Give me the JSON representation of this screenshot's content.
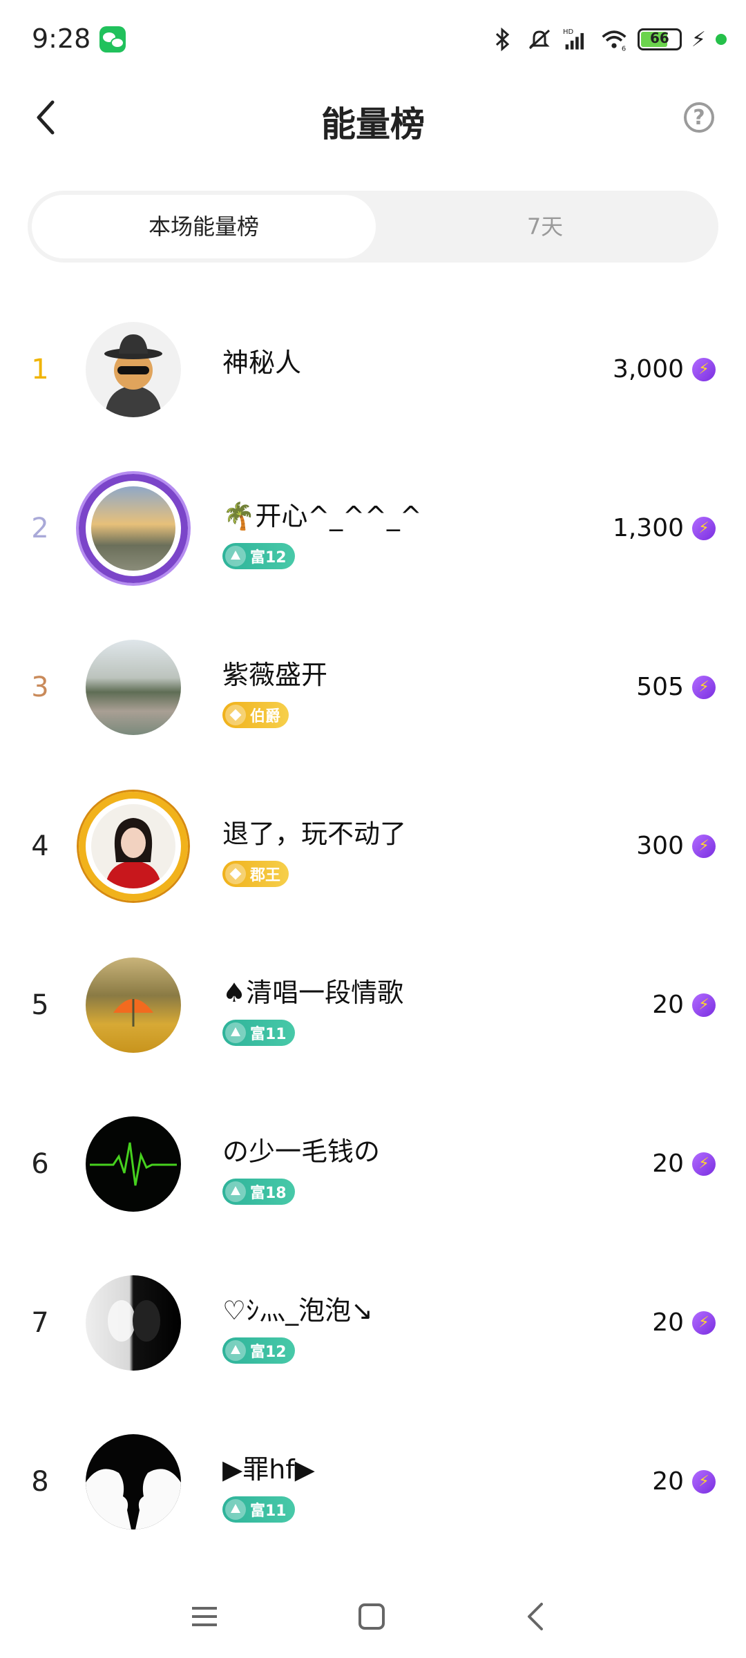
{
  "status_bar": {
    "time": "9:28",
    "battery_level": "66",
    "icons": [
      "wechat-icon",
      "bluetooth-icon",
      "mute-icon",
      "hd-signal-icon",
      "wifi-icon",
      "battery-icon",
      "charging-icon"
    ]
  },
  "header": {
    "title": "能量榜",
    "help_symbol": "?"
  },
  "tabs": [
    {
      "label": "本场能量榜",
      "active": true
    },
    {
      "label": "7天",
      "active": false
    }
  ],
  "ranking": [
    {
      "rank": "1",
      "rank_color": "#f0b400",
      "name": "神秘人",
      "badge": null,
      "score": "3,000",
      "avatar": "mystery-man"
    },
    {
      "rank": "2",
      "rank_color": "#a9a9d8",
      "name": "🌴开心^_^^_^",
      "badge": {
        "type": "rich",
        "label": "富12"
      },
      "score": "1,300",
      "avatar": "sunset-lake"
    },
    {
      "rank": "3",
      "rank_color": "#c98a5a",
      "name": "紫薇盛开",
      "badge": {
        "type": "noble",
        "label": "伯爵"
      },
      "score": "505",
      "avatar": "village-pond"
    },
    {
      "rank": "4",
      "rank_color": "#222222",
      "name": "退了，玩不动了",
      "badge": {
        "type": "noble",
        "label": "郡王"
      },
      "score": "300",
      "avatar": "woman-red"
    },
    {
      "rank": "5",
      "rank_color": "#222222",
      "name": "♠清唱一段情歌",
      "badge": {
        "type": "rich",
        "label": "富11"
      },
      "score": "20",
      "avatar": "autumn-umbrella"
    },
    {
      "rank": "6",
      "rank_color": "#222222",
      "name": "の少一毛钱の",
      "badge": {
        "type": "rich",
        "label": "富18"
      },
      "score": "20",
      "avatar": "heartbeat"
    },
    {
      "rank": "7",
      "rank_color": "#222222",
      "name": "♡ｼ灬_泡泡↘",
      "badge": {
        "type": "rich",
        "label": "富12"
      },
      "score": "20",
      "avatar": "bw-face"
    },
    {
      "rank": "8",
      "rank_color": "#222222",
      "name": "▶罪hf▶",
      "badge": {
        "type": "rich",
        "label": "富11"
      },
      "score": "20",
      "avatar": "silhouette-kiss"
    }
  ],
  "energy_icon": "lightning-bolt-icon",
  "nav": {
    "buttons": [
      "menu",
      "home",
      "back"
    ]
  }
}
